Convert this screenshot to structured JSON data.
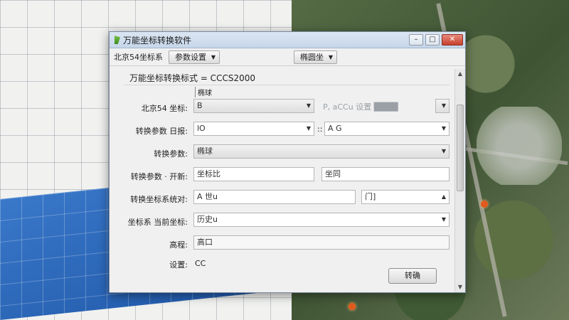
{
  "window": {
    "title": "万能坐标转换软件"
  },
  "toolbar": {
    "label": "北京54坐标系",
    "menu1": "参数设置",
    "menu2": "椭圆坐"
  },
  "form": {
    "heading": "万能坐标转换标式 = CCCS2000",
    "subhead": "椭球",
    "rows": [
      {
        "label": "北京54 坐标:",
        "value": "B",
        "extra": "P, aCCu   设置 ████"
      },
      {
        "label": "转换参数  日报:",
        "value": "lO",
        "mid": "::",
        "value2": "A G"
      },
      {
        "label": "转换参数:",
        "value": "椭球"
      },
      {
        "label": "转换参数 · 开新:",
        "value": "坐标比",
        "value2": "坐同"
      },
      {
        "label": "转换坐标系统对:",
        "value": "A 世u",
        "value2": "门]"
      },
      {
        "label": "坐标系  当前坐标:",
        "value": "历史u"
      },
      {
        "label": "高程:",
        "value": "高口"
      },
      {
        "label": "设置:",
        "value": "CC"
      }
    ]
  },
  "actions": {
    "ok": "转确"
  },
  "icons": {
    "minimize": "minimize-icon",
    "maximize": "maximize-icon",
    "close": "close-icon"
  },
  "colors": {
    "title_bar": "#c6d6ea",
    "close": "#c7402d"
  }
}
